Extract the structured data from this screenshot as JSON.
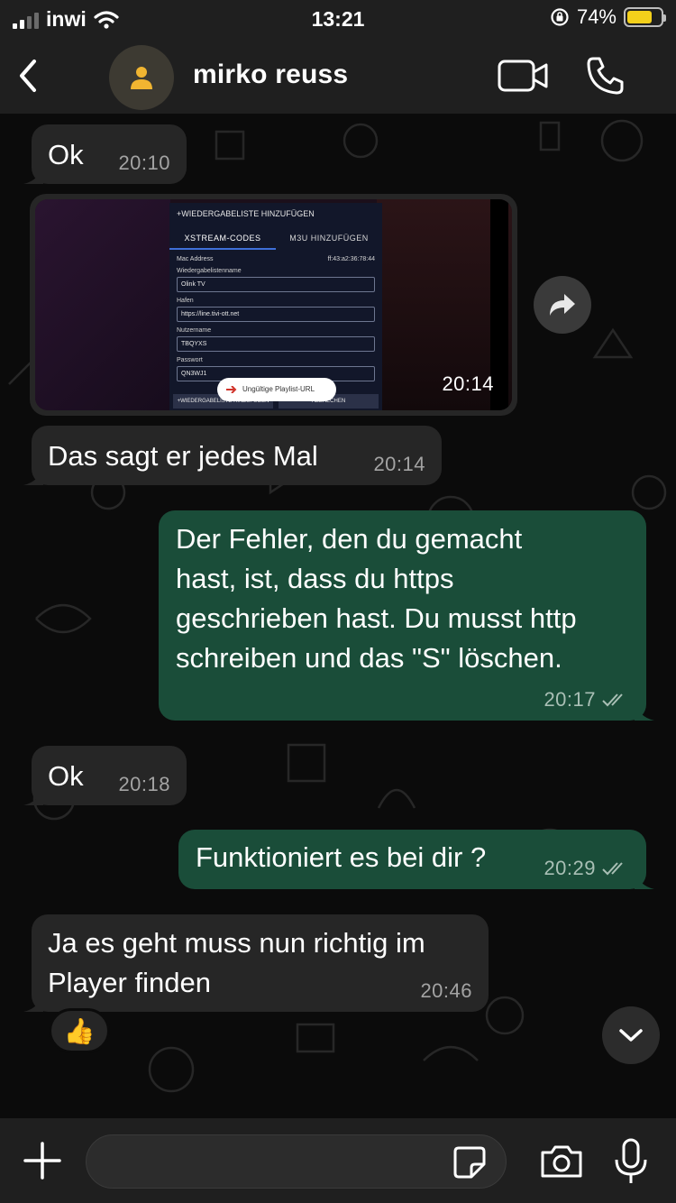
{
  "status_bar": {
    "carrier": "inwi",
    "time": "13:21",
    "battery_percent": "74%",
    "battery_level": 0.74,
    "icons": [
      "signal-icon",
      "wifi-icon",
      "rotation-lock-icon",
      "battery-icon"
    ]
  },
  "header": {
    "contact_name": "mirko reuss",
    "icons": [
      "back-chevron-icon",
      "avatar-person-icon",
      "video-camera-icon",
      "phone-icon"
    ]
  },
  "messages": [
    {
      "id": "m1",
      "direction": "incoming",
      "text": "Ok",
      "time": "20:10"
    },
    {
      "id": "m2",
      "direction": "incoming",
      "type": "image",
      "time": "20:14",
      "image_content": {
        "dialog_title": "+WIEDERGABELISTE HINZUFÜGEN",
        "tab_active": "XSTREAM-CODES",
        "tab_other": "M3U HINZUFÜGEN",
        "mac_label": "Mac Address",
        "mac_value": "ff:43:a2:36:78:44",
        "playlist_label": "Wiedergabelistenname",
        "playlist_value": "Olink TV",
        "host_label": "Hafen",
        "host_value": "https://line.tivi-ott.net",
        "user_label": "Nutzername",
        "user_value": "TBQYXS",
        "pass_label": "Passwort",
        "pass_value": "QN3WJ1",
        "toast": "Ungültige Playlist-URL",
        "btn_add": "+WIEDERGABELISTE HINZUFÜGEN",
        "btn_cancel": "ABBRECHEN"
      }
    },
    {
      "id": "m3",
      "direction": "incoming",
      "text": "Das sagt er jedes Mal",
      "time": "20:14"
    },
    {
      "id": "m4",
      "direction": "outgoing",
      "lines": [
        "Der Fehler, den du gemacht",
        "hast, ist, dass du https",
        "geschrieben hast. Du musst http",
        "schreiben und das \"S\" löschen."
      ],
      "time": "20:17",
      "status": "read"
    },
    {
      "id": "m5",
      "direction": "incoming",
      "text": "Ok",
      "time": "20:18"
    },
    {
      "id": "m6",
      "direction": "outgoing",
      "text": "Funktioniert es bei dir ?",
      "time": "20:29",
      "status": "read"
    },
    {
      "id": "m7",
      "direction": "incoming",
      "lines": [
        "Ja es geht muss nun richtig im",
        "Player finden"
      ],
      "time": "20:46",
      "reaction": "👍"
    }
  ],
  "input_bar": {
    "placeholder": "",
    "icons": [
      "plus-icon",
      "sticker-icon",
      "camera-icon",
      "microphone-icon"
    ]
  },
  "colors": {
    "background": "#0b0b0b",
    "bar": "#1f1f1f",
    "incoming_bubble": "#262626",
    "outgoing_bubble": "#1a4d39",
    "battery": "#f3d01b"
  }
}
